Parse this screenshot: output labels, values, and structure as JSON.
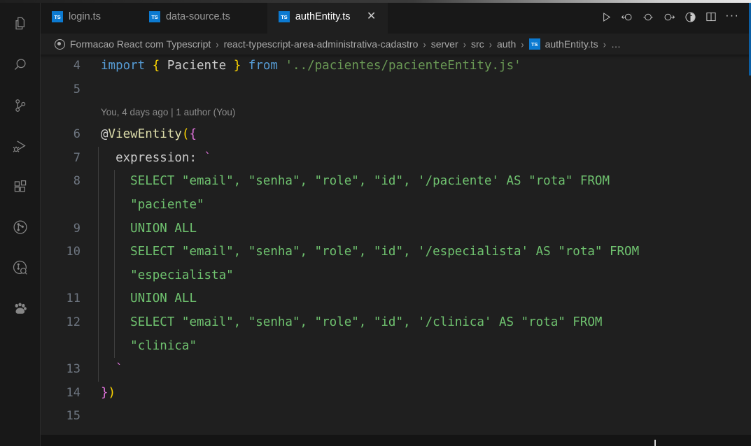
{
  "window": {
    "accent_color": "#0b5fa5",
    "background": "#1f1f1f"
  },
  "activity_bar": {
    "items": [
      {
        "name": "explorer-icon",
        "label": "Explorer"
      },
      {
        "name": "search-icon",
        "label": "Search"
      },
      {
        "name": "source-control-icon",
        "label": "Source Control"
      },
      {
        "name": "run-and-debug-icon",
        "label": "Run and Debug"
      },
      {
        "name": "extensions-icon",
        "label": "Extensions"
      },
      {
        "name": "git-graph-icon",
        "label": "Git Graph"
      },
      {
        "name": "git-inspect-icon",
        "label": "Git Inspect"
      },
      {
        "name": "paw-icon",
        "label": "Thunder Client"
      }
    ]
  },
  "tabs": [
    {
      "label": "login.ts",
      "badge": "TS",
      "active": false,
      "close": "✕"
    },
    {
      "label": "data-source.ts",
      "badge": "TS",
      "active": false,
      "close": "✕"
    },
    {
      "label": "authEntity.ts",
      "badge": "TS",
      "active": true,
      "close": "✕"
    }
  ],
  "tab_actions": [
    {
      "name": "run-button",
      "label": "Run"
    },
    {
      "name": "step-back-button",
      "label": "Step Back"
    },
    {
      "name": "test-circle-button",
      "label": "Run Tests"
    },
    {
      "name": "step-forward-button",
      "label": "Step Forward"
    },
    {
      "name": "coverage-button",
      "label": "Run with Coverage"
    },
    {
      "name": "split-editor-button",
      "label": "Split Editor Right"
    },
    {
      "name": "more-actions-button",
      "label": "···"
    }
  ],
  "breadcrumb": {
    "segments": [
      {
        "text": "Formacao React com Typescript",
        "icon": "workspace-circle-icon"
      },
      {
        "text": "react-typescript-area-administrativa-cadastro",
        "icon": null
      },
      {
        "text": "server",
        "icon": null
      },
      {
        "text": "src",
        "icon": null
      },
      {
        "text": "auth",
        "icon": null
      },
      {
        "text": "authEntity.ts",
        "icon": "ts-file-icon"
      },
      {
        "text": "…",
        "icon": null
      }
    ],
    "separator": "›"
  },
  "codelens": {
    "text": "You, 4 days ago | 1 author (You)"
  },
  "editor": {
    "language": "typescript",
    "first_visible_line": 4,
    "last_visible_line": 15,
    "lines": [
      {
        "number": "4",
        "text": "import { Paciente } from '../pacientes/pacienteEntity.js'"
      },
      {
        "number": "5",
        "text": ""
      },
      {
        "number": "6",
        "text": "@ViewEntity({"
      },
      {
        "number": "7",
        "text": "  expression: `"
      },
      {
        "number": "8",
        "text": "    SELECT \"email\", \"senha\", \"role\", \"id\", '/paciente' AS \"rota\" FROM \"paciente\""
      },
      {
        "number": "9",
        "text": "    UNION ALL"
      },
      {
        "number": "10",
        "text": "    SELECT \"email\", \"senha\", \"role\", \"id\", '/especialista' AS \"rota\" FROM \"especialista\""
      },
      {
        "number": "11",
        "text": "    UNION ALL"
      },
      {
        "number": "12",
        "text": "    SELECT \"email\", \"senha\", \"role\", \"id\", '/clinica' AS \"rota\" FROM \"clinica\""
      },
      {
        "number": "13",
        "text": "  `"
      },
      {
        "number": "14",
        "text": "})"
      },
      {
        "number": "15",
        "text": ""
      }
    ],
    "tokens": {
      "line4": {
        "kw_import": "import",
        "brace_open": "{",
        "ident": "Paciente",
        "brace_close": "}",
        "kw_from": "from",
        "module": "'../pacientes/pacienteEntity.js'"
      },
      "line6": {
        "at": "@",
        "decorator": "ViewEntity",
        "paren": "(",
        "brace": "{"
      },
      "line7": {
        "prop": "expression",
        "colon": ":",
        "tick": "`"
      },
      "line8a": "SELECT \"email\", \"senha\", \"role\", \"id\", '/paciente' AS \"rota\" FROM",
      "line8b": "\"paciente\"",
      "line9": "UNION ALL",
      "line10a": "SELECT \"email\", \"senha\", \"role\", \"id\", '/especialista' AS \"rota\" FROM",
      "line10b": "\"especialista\"",
      "line11": "UNION ALL",
      "line12a": "SELECT \"email\", \"senha\", \"role\", \"id\", '/clinica' AS \"rota\" FROM",
      "line12b": "\"clinica\"",
      "line13": "`",
      "line14_brace": "}",
      "line14_paren": ")"
    },
    "colors": {
      "keyword": "#569cd6",
      "string": "#6a9955",
      "sql_string": "#6fc26f",
      "decorator": "#dcdcaa",
      "identifier": "#9cdcfe",
      "bracket_yellow": "#ffd700",
      "bracket_pink": "#da70d6",
      "line_number": "#6e7681",
      "foreground": "#cccccc"
    }
  }
}
